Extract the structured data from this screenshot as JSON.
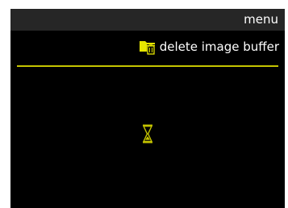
{
  "header": {
    "title": "menu"
  },
  "subheader": {
    "icon": "folder-delete-icon",
    "title": "delete image buffer"
  },
  "status": {
    "icon": "hourglass-icon"
  },
  "colors": {
    "accent": "#c5c400",
    "background": "#000000",
    "header": "#262626",
    "text": "#ffffff"
  }
}
